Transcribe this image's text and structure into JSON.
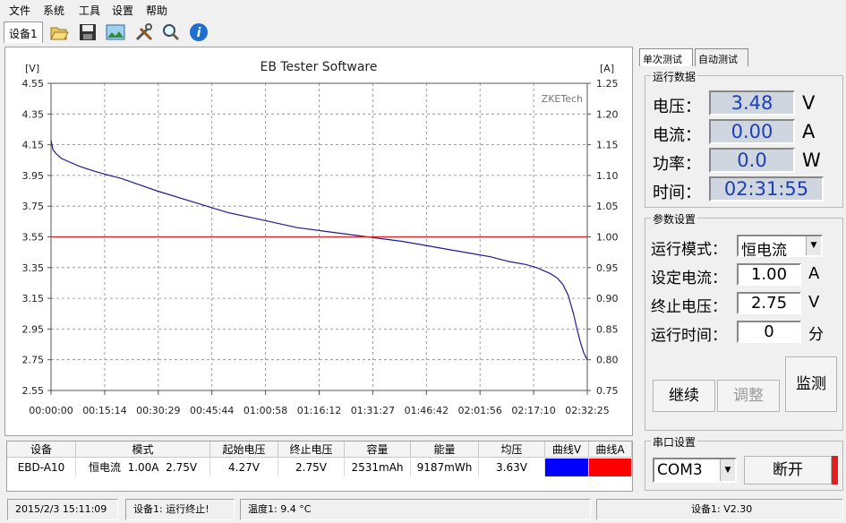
{
  "menu": {
    "items": [
      "文件",
      "系统",
      "工具",
      "设置",
      "帮助"
    ]
  },
  "toolbar": {
    "device_label": "设备1",
    "icons": [
      "open-folder-icon",
      "save-disk-icon",
      "chart-image-icon",
      "tools-icon",
      "magnifier-icon",
      "info-icon"
    ]
  },
  "chart": {
    "title": "EB Tester Software",
    "watermark": "ZKETech",
    "left_unit": "[V]",
    "right_unit": "[A]"
  },
  "chart_data": {
    "type": "line",
    "title": "EB Tester Software",
    "ylabel_left": "[V]",
    "ylabel_right": "[A]",
    "ylim_left": [
      2.55,
      4.55
    ],
    "ylim_right": [
      0.75,
      1.25
    ],
    "y_ticks_left": [
      "4.55",
      "4.35",
      "4.15",
      "3.95",
      "3.75",
      "3.55",
      "3.35",
      "3.15",
      "2.95",
      "2.75",
      "2.55"
    ],
    "y_ticks_right": [
      "1.25",
      "1.20",
      "1.15",
      "1.10",
      "1.05",
      "1.00",
      "0.95",
      "0.90",
      "0.85",
      "0.80",
      "0.75"
    ],
    "x_ticks": [
      "00:00:00",
      "00:15:14",
      "00:30:29",
      "00:45:44",
      "01:00:58",
      "01:16:12",
      "01:31:27",
      "01:46:42",
      "02:01:56",
      "02:17:10",
      "02:32:25"
    ],
    "grid": true,
    "series": [
      {
        "color": "#1c1c8c",
        "axis": "left",
        "x_minutes": [
          0,
          0.5,
          1.5,
          3,
          5,
          8,
          12,
          15,
          20,
          25,
          30,
          40,
          50,
          60,
          70,
          80,
          90,
          100,
          110,
          120,
          125,
          130,
          135,
          138,
          140,
          142,
          144,
          145.5,
          147,
          148.5,
          149.5,
          150.5,
          151.5,
          152.4
        ],
        "y_volts": [
          4.18,
          4.12,
          4.09,
          4.06,
          4.04,
          4.01,
          3.98,
          3.96,
          3.93,
          3.89,
          3.85,
          3.78,
          3.71,
          3.66,
          3.61,
          3.58,
          3.55,
          3.52,
          3.48,
          3.44,
          3.42,
          3.39,
          3.37,
          3.35,
          3.33,
          3.31,
          3.28,
          3.24,
          3.17,
          3.05,
          2.95,
          2.86,
          2.79,
          2.75
        ]
      },
      {
        "color": "#e02020",
        "axis": "right",
        "x_minutes": [
          0,
          152.4
        ],
        "y_amps": [
          1.0,
          1.0
        ]
      }
    ]
  },
  "tabs": [
    {
      "label": "单次测试",
      "active": true
    },
    {
      "label": "自动测试",
      "active": false
    }
  ],
  "run_data": {
    "title": "运行数据",
    "voltage": {
      "label": "电压：",
      "value": "3.48",
      "unit": "V"
    },
    "current": {
      "label": "电流：",
      "value": "0.00",
      "unit": "A"
    },
    "power": {
      "label": "功率：",
      "value": "0.0",
      "unit": "W"
    },
    "time": {
      "label": "时间：",
      "value": "02:31:55"
    }
  },
  "params": {
    "title": "参数设置",
    "mode": {
      "label": "运行模式：",
      "value": "恒电流"
    },
    "set_current": {
      "label": "设定电流：",
      "value": "1.00",
      "unit": "A"
    },
    "cutoff_voltage": {
      "label": "终止电压：",
      "value": "2.75",
      "unit": "V"
    },
    "run_time": {
      "label": "运行时间：",
      "value": "0",
      "unit": "分"
    }
  },
  "buttons": {
    "continue": "继续",
    "adjust": "调整",
    "monitor": "监测"
  },
  "serial": {
    "title": "串口设置",
    "port": "COM3",
    "disconnect": "断开"
  },
  "table": {
    "headers": [
      "设备",
      "模式",
      "起始电压",
      "终止电压",
      "容量",
      "能量",
      "均压",
      "曲线V",
      "曲线A"
    ],
    "rows": [
      [
        "EBD-A10",
        "恒电流  1.00A  2.75V",
        "4.27V",
        "2.75V",
        "2531mAh",
        "9187mWh",
        "3.63V",
        "",
        ""
      ]
    ],
    "curve_colors": [
      "#0000ff",
      "#ff0000"
    ]
  },
  "status": {
    "datetime": "2015/2/3 15:11:09",
    "device_status": "设备1: 运行终止!",
    "temperature": "温度1: 9.4 °C",
    "version": "设备1: V2.30"
  }
}
